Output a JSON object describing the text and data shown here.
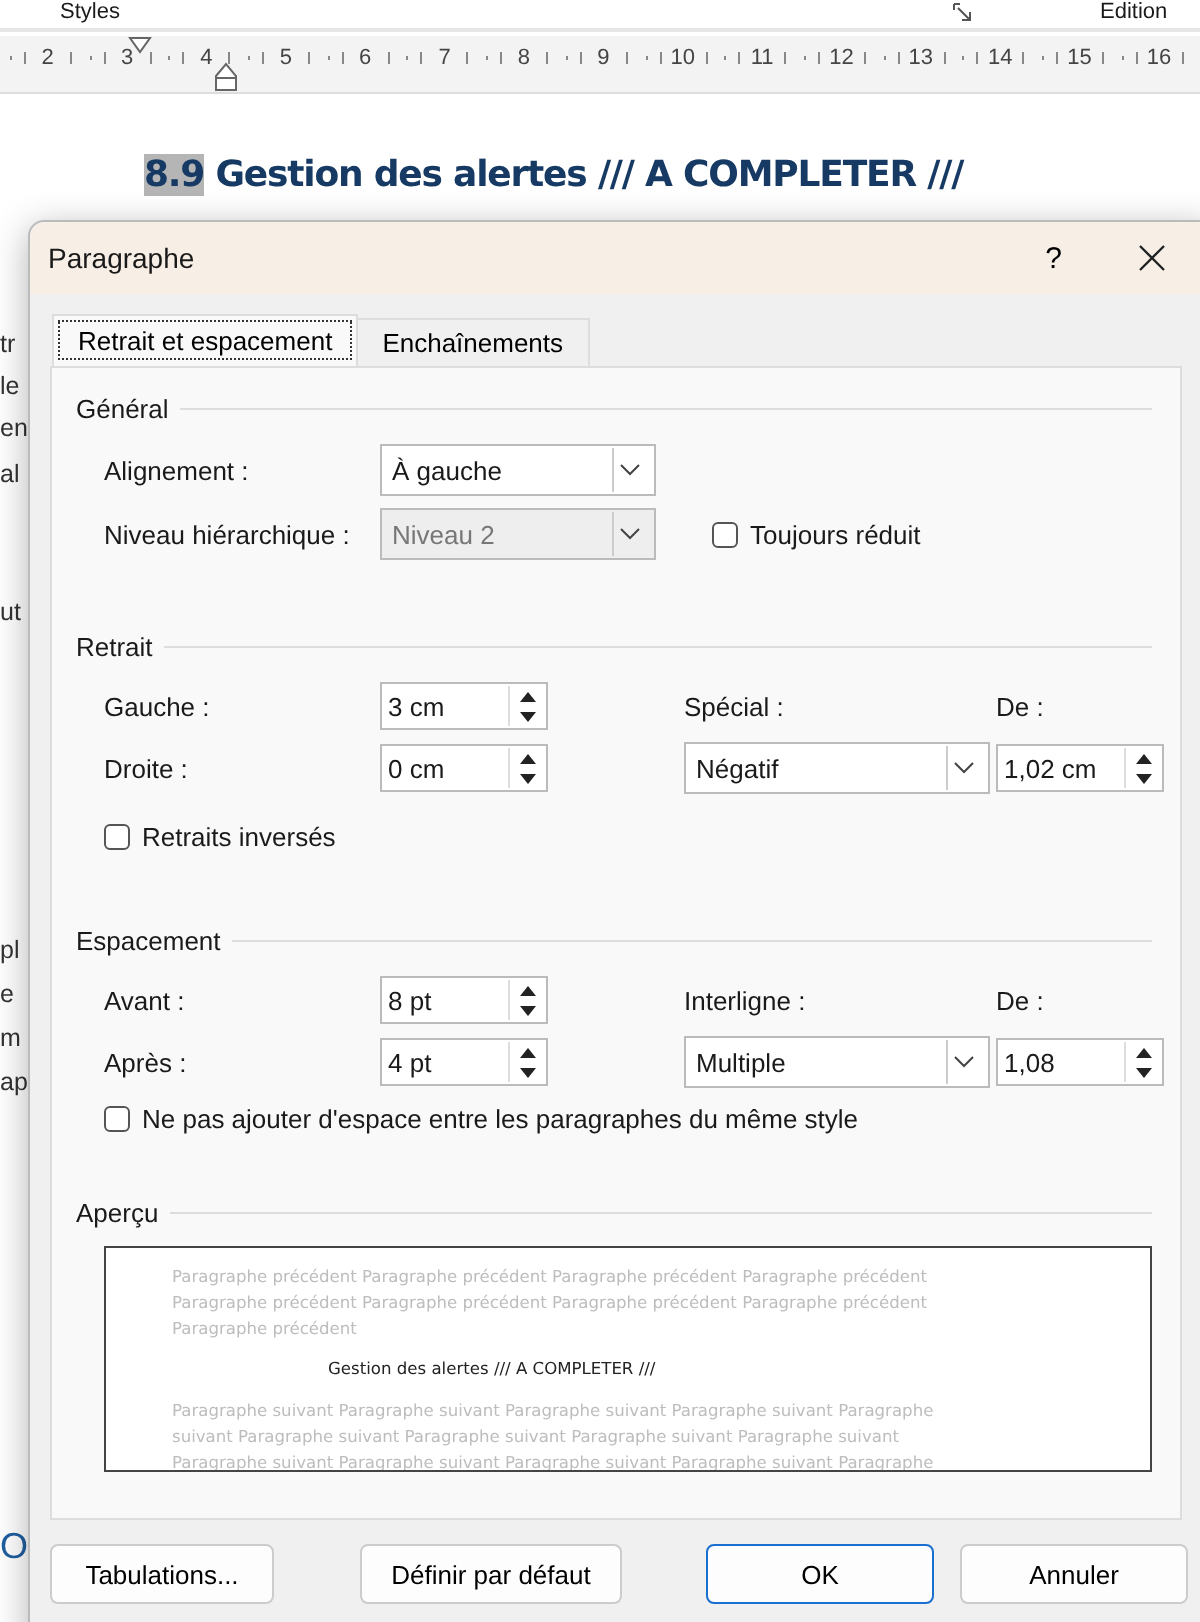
{
  "ribbon": {
    "groups": [
      "Styles",
      "Edition"
    ]
  },
  "ruler": {
    "marks": [
      "2",
      "3",
      "4",
      "5",
      "6",
      "7",
      "8",
      "9",
      "10",
      "11",
      "12",
      "13",
      "14",
      "15",
      "16"
    ]
  },
  "document": {
    "heading_number": "8.9",
    "heading": "Gestion des alertes /// A COMPLETER ///",
    "margin_fragments": [
      "tr",
      "le",
      "en",
      "al",
      "ut",
      "pl",
      "e",
      "m",
      "ap",
      "O"
    ]
  },
  "dialog": {
    "title": "Paragraphe",
    "help": "?",
    "tabs": [
      {
        "label": "Retrait et espacement",
        "selected": true
      },
      {
        "label": "Enchaînements",
        "selected": false
      }
    ],
    "general": {
      "title": "Général",
      "alignment": {
        "label": "Alignement :",
        "value": "À gauche",
        "disabled": false
      },
      "outline_level": {
        "label": "Niveau hiérarchique :",
        "value": "Niveau 2",
        "disabled": true
      },
      "collapsed": {
        "label": "Toujours réduit",
        "checked": false
      }
    },
    "indent": {
      "title": "Retrait",
      "left": {
        "label": "Gauche :",
        "value": "3 cm"
      },
      "right": {
        "label": "Droite :",
        "value": "0 cm"
      },
      "special": {
        "label": "Spécial :",
        "value": "Négatif"
      },
      "by": {
        "label": "De :",
        "value": "1,02 cm"
      },
      "mirror": {
        "label": "Retraits inversés",
        "checked": false
      }
    },
    "spacing": {
      "title": "Espacement",
      "before": {
        "label": "Avant :",
        "value": "8 pt"
      },
      "after": {
        "label": "Après :",
        "value": "4 pt"
      },
      "line_spacing": {
        "label": "Interligne :",
        "value": "Multiple"
      },
      "at": {
        "label": "De :",
        "value": "1,08"
      },
      "no_space": {
        "label": "Ne pas ajouter d'espace entre les paragraphes du même style",
        "checked": false
      }
    },
    "preview": {
      "title": "Aperçu",
      "previous_lines": [
        "Paragraphe précédent Paragraphe précédent Paragraphe précédent Paragraphe précédent",
        "Paragraphe précédent Paragraphe précédent Paragraphe précédent Paragraphe précédent",
        "Paragraphe précédent"
      ],
      "sample": "Gestion des alertes /// A COMPLETER ///",
      "next_lines": [
        "Paragraphe suivant Paragraphe suivant Paragraphe suivant Paragraphe suivant Paragraphe",
        "suivant Paragraphe suivant Paragraphe suivant Paragraphe suivant Paragraphe suivant",
        "Paragraphe suivant Paragraphe suivant Paragraphe suivant Paragraphe suivant Paragraphe"
      ]
    },
    "buttons": [
      {
        "label": "Tabulations...",
        "default": false
      },
      {
        "label": "Définir par défaut",
        "default": false
      },
      {
        "label": "OK",
        "default": true
      },
      {
        "label": "Annuler",
        "default": false
      }
    ]
  }
}
